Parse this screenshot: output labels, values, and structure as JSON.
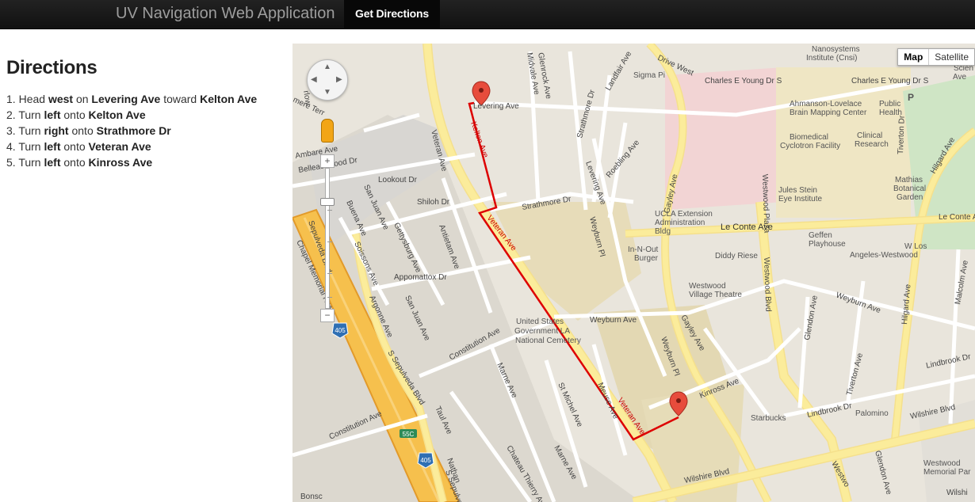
{
  "navbar": {
    "brand": "UV Navigation Web Application",
    "active_tab": "Get Directions"
  },
  "directions": {
    "heading": "Directions",
    "steps": [
      {
        "n": "1.",
        "a": "Head ",
        "b": "west",
        "c": " on ",
        "d": "Levering Ave",
        "e": " toward ",
        "f": "Kelton Ave"
      },
      {
        "n": "2.",
        "a": "Turn ",
        "b": "left",
        "c": " onto ",
        "d": "Kelton Ave",
        "e": "",
        "f": ""
      },
      {
        "n": "3.",
        "a": "Turn ",
        "b": "right",
        "c": " onto ",
        "d": "Strathmore Dr",
        "e": "",
        "f": ""
      },
      {
        "n": "4.",
        "a": "Turn ",
        "b": "left",
        "c": " onto ",
        "d": "Veteran Ave",
        "e": "",
        "f": ""
      },
      {
        "n": "5.",
        "a": "Turn ",
        "b": "left",
        "c": " onto ",
        "d": "Kinross Ave",
        "e": "",
        "f": ""
      }
    ]
  },
  "map": {
    "type_map": "Map",
    "type_satellite": "Satellite",
    "zoom_in": "+",
    "zoom_out": "−",
    "route_color": "#dd0000",
    "labels": {
      "veteran_ave": "Veteran Ave",
      "veteran_ave_2": "Veteran Ave",
      "veteran_ave_3": "Veteran Ave",
      "levering_ave": "Levering Ave",
      "kelton_ave": "Kelton Ave",
      "strathmore_dr": "Strathmore Dr",
      "strathmore_dr_2": "Strathmore Dr",
      "levering_ave_2": "Levering Ave",
      "weyburn_pl": "Weyburn Pl",
      "weyburn_ave": "Weyburn Ave",
      "weyburn_ave_2": "Weyburn Ave",
      "weyburn_pl_2": "Weyburn Pl",
      "gayley_ave": "Gayley Ave",
      "gayley_ave_2": "Gayley Ave",
      "westwood_plaza": "Westwood Plaza",
      "westwood_blvd": "Westwood Blvd",
      "le_conte_ave": "Le Conte Ave",
      "le_conte_ave_2": "Le Conte Ave",
      "charles_young": "Charles E Young Dr S",
      "charles_young_2": "Charles E Young Dr S",
      "hilgard_ave": "Hilgard Ave",
      "hilgard_ave_2": "Hilgard Ave",
      "kinross_ave": "Kinross Ave",
      "lindbrook_dr": "Lindbrook Dr",
      "lindbrook_dr_2": "Lindbrook Dr",
      "wilshire_blvd": "Wilshire Blvd",
      "wilshire_blvd_2": "Wilshire Blvd",
      "s_sepulveda": "S Sepulveda Blvd",
      "s_sepulveda_2": "S Sepulveda",
      "sepulveda_blvd": "Sepulveda Blvd",
      "chapel_memorial": "Chapel Memorial Hwy",
      "constitution_ave": "Constitution Ave",
      "constitution_ave_2": "Constitution Ave",
      "constitution_ave_3": "Constitution Ave",
      "cemetery": "United States Government LA National Cemetery",
      "cemetery_1": "United States",
      "cemetery_2": "Government LA",
      "cemetery_3": "National Cemetery",
      "ucla_ext_1": "UCLA Extension",
      "ucla_ext_2": "Administration",
      "ucla_ext_3": "Bldg",
      "innout_1": "In-N-Out",
      "innout_2": "Burger",
      "diddy": "Diddy Riese",
      "westwood_village_1": "Westwood",
      "westwood_village_2": "Village Theatre",
      "geffen_1": "Geffen",
      "geffen_2": "Playhouse",
      "angeles": "Angeles-Westwood",
      "w_los": "W Los",
      "starbucks": "Starbucks",
      "palomino": "Palomino",
      "westwood_memorial_1": "Westwood",
      "westwood_memorial_2": "Memorial Par",
      "mathias_1": "Mathias",
      "mathias_2": "Botanical",
      "mathias_3": "Garden",
      "jules_1": "Jules Stein",
      "jules_2": "Eye Institute",
      "ahmanson_1": "Ahmanson-Lovelace",
      "ahmanson_2": "Brain Mapping Center",
      "biomed_1": "Biomedical",
      "biomed_2": "Cyclotron Facility",
      "clinical_1": "Clinical",
      "clinical_2": "Research",
      "public_1": "Public",
      "public_2": "Health",
      "nano_1": "Nanosystems",
      "nano_2": "Institute (Cnsi)",
      "sigma": "Sigma Pi",
      "landfair": "Landfair Ave",
      "strathmore_dr_3": "Strathmore Dr",
      "roebling": "Roebling Ave",
      "midvale": "Midvale Ave",
      "glenrock": "Glenrock Ave",
      "drive_west": "Drive West",
      "lookout": "Lookout Dr",
      "belleau": "Belleau Wood Dr",
      "ambare": "Ambare Ave",
      "buena": "Buena Ave",
      "san_juan": "San Juan Ave",
      "san_juan_2": "San Juan Ave",
      "shiloh": "Shiloh Dr",
      "gettysburg": "Gettysburg Ave",
      "antietam": "Antietam Ave",
      "soissons": "Soissons Ave",
      "appomattox": "Appomattox Dr",
      "argonne": "Argonne Ave",
      "marne": "Marne Ave",
      "marne_2": "Marne Ave",
      "st_michel": "St Michel Ave",
      "meuse": "Meuse Ave",
      "chateau": "Chateau Thierry Ave",
      "taul": "Taul Ave",
      "bonsc": "Bonsc",
      "nathan": "Nathan",
      "tiverton": "Tiverton Ave",
      "tiverton_dr": "Tiverton Dr",
      "glendon": "Glendon Ave",
      "glendon_2": "Glendon Ave",
      "malcolm": "Malcolm Ave",
      "scien": "Scien",
      "westwo": "Westwo",
      "shield_405": "405",
      "shield_405_2": "405",
      "shield_55c": "55C",
      "ave_frag": "Ave",
      "mere_frag": "mere Terr",
      "rlow_frag": "rlow",
      "p_letter": "P",
      "wilshire_frag": "Wilshi"
    }
  }
}
